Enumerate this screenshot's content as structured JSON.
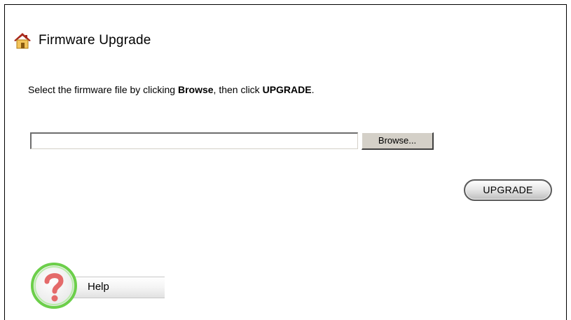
{
  "page": {
    "title": "Firmware Upgrade",
    "title_icon": "home-icon"
  },
  "instruction": {
    "prefix": "Select the firmware file by clicking ",
    "browse_word": "Browse",
    "middle": ", then click ",
    "upgrade_word": "UPGRADE",
    "suffix": "."
  },
  "file_input": {
    "value": "",
    "browse_label": "Browse..."
  },
  "actions": {
    "upgrade_label": "UPGRADE"
  },
  "help": {
    "label": "Help",
    "icon": "help-question-icon"
  },
  "colors": {
    "help_ring": "#6ccf4a",
    "help_question": "#e46a6a",
    "home_roof": "#c0392b"
  }
}
